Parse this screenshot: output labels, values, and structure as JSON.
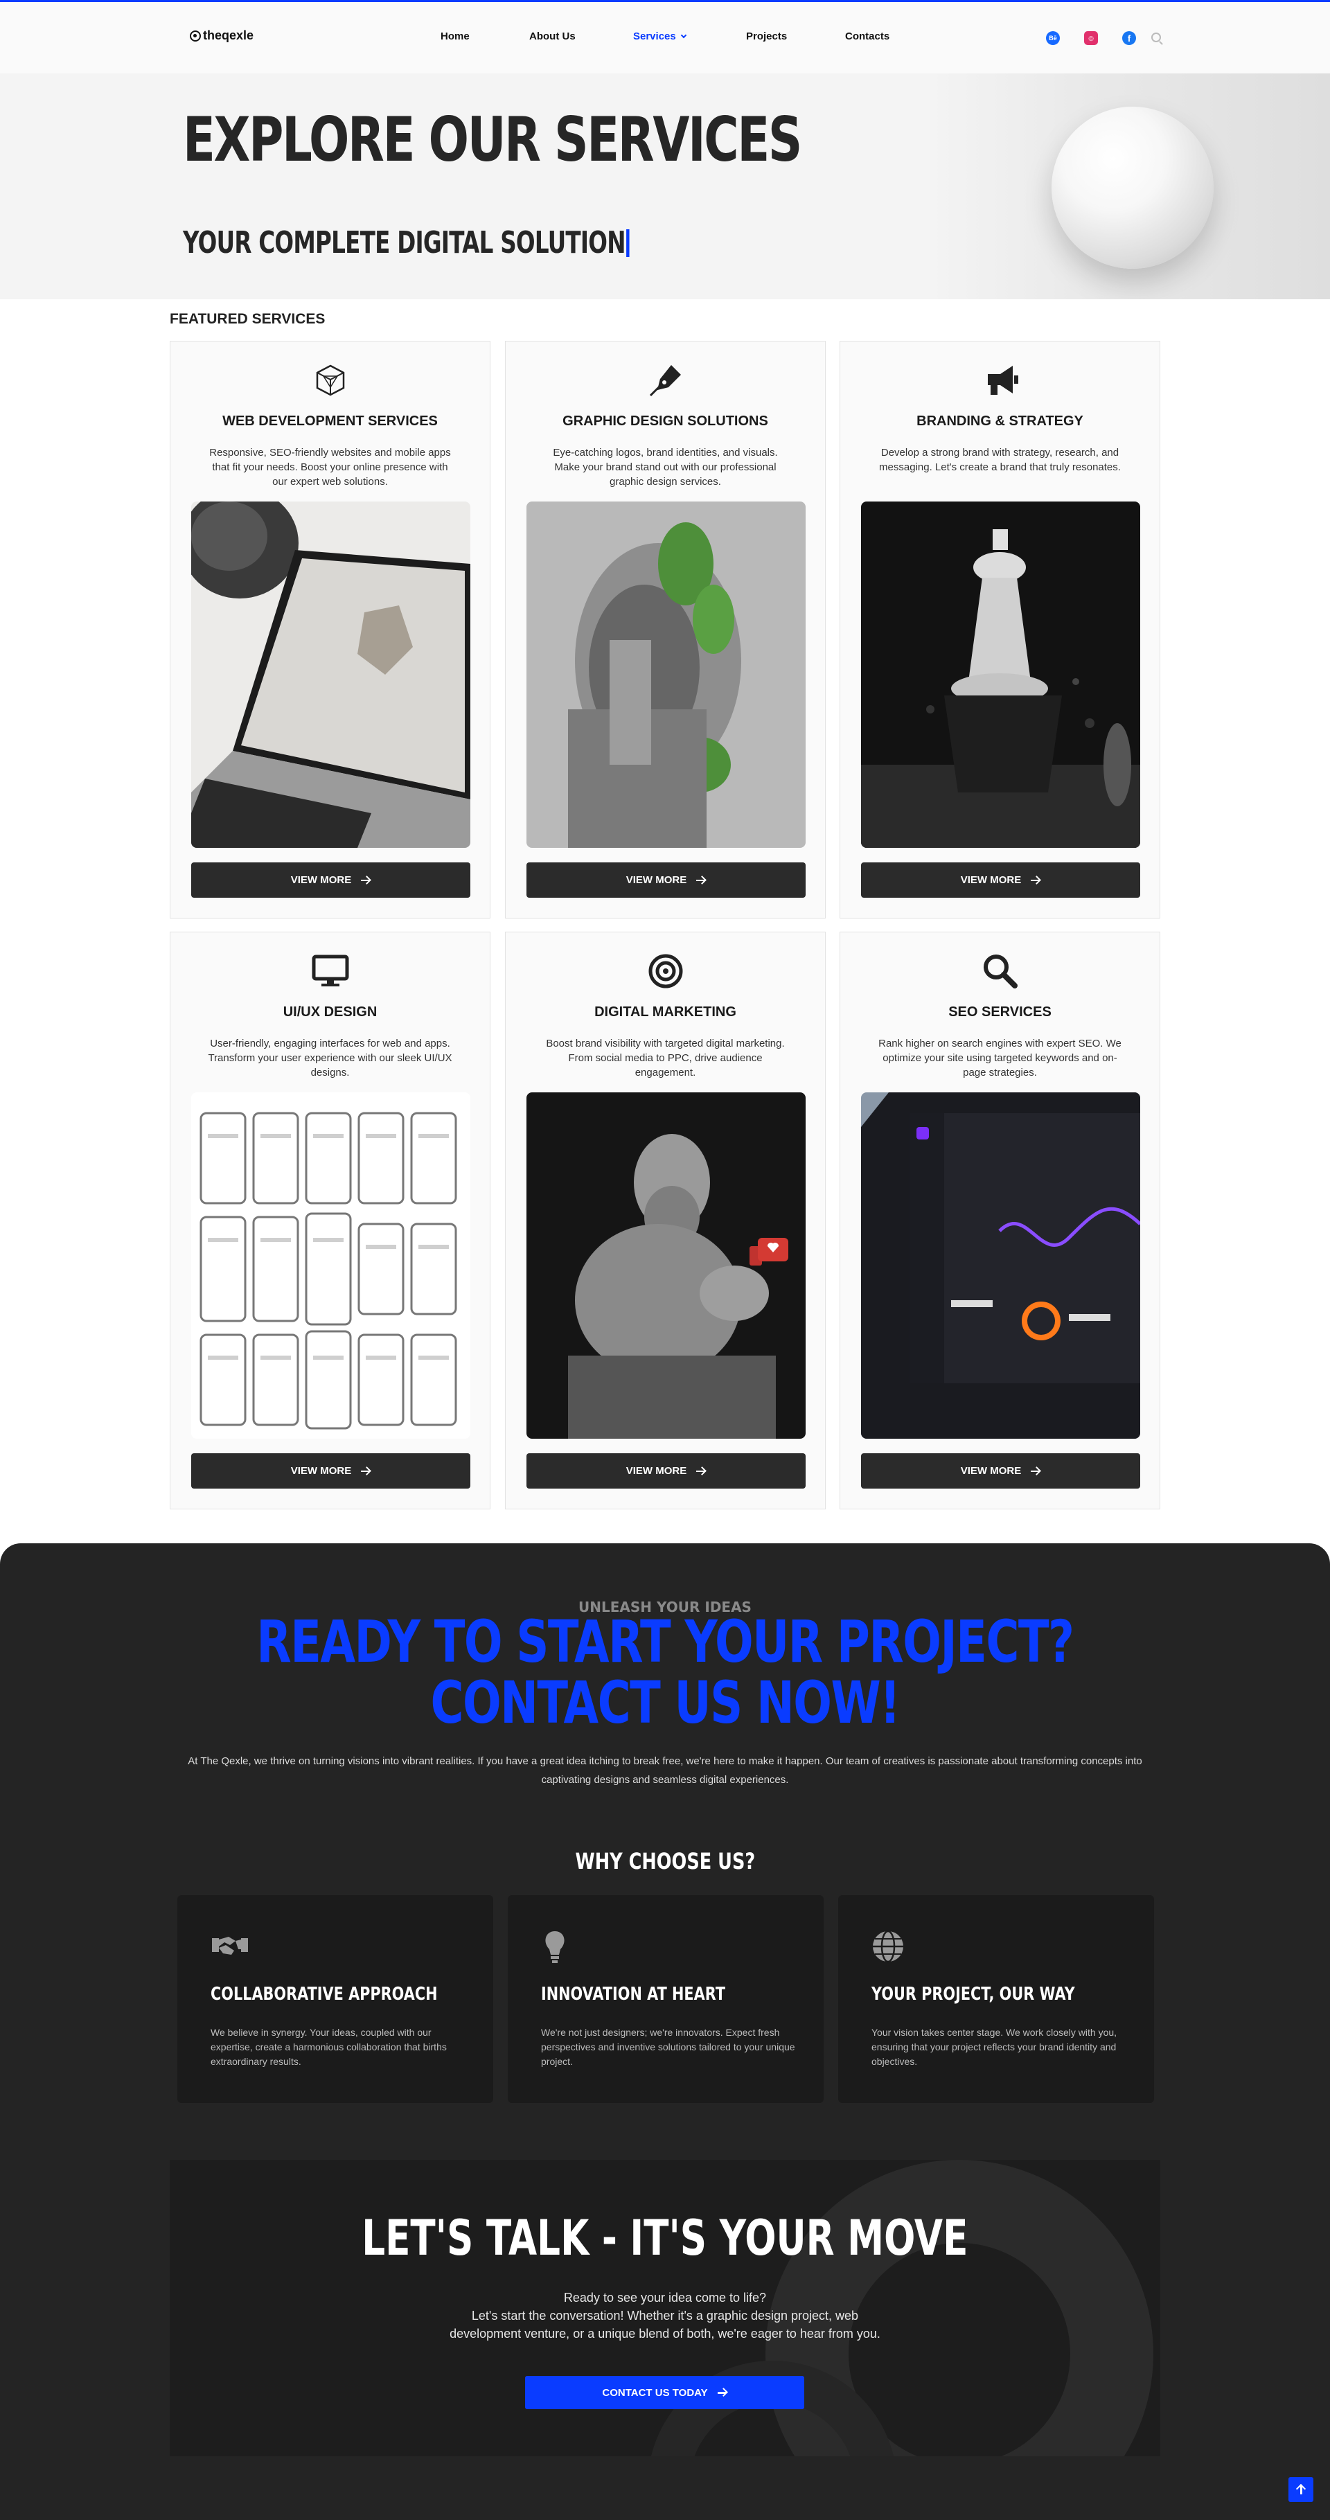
{
  "header": {
    "logo": "theqexle",
    "nav": [
      {
        "label": "Home"
      },
      {
        "label": "About Us"
      },
      {
        "label": "Services"
      },
      {
        "label": "Projects"
      },
      {
        "label": "Contacts"
      }
    ],
    "active_nav": "Services",
    "social_icons": [
      "behance-icon",
      "instagram-icon",
      "facebook-icon",
      "search-icon"
    ],
    "social_labels": {
      "behance": "Bē",
      "instagram": "◎",
      "facebook": "f"
    }
  },
  "hero": {
    "title": "EXPLORE OUR SERVICES",
    "subtitle": "YOUR COMPLETE DIGITAL SOLUTION"
  },
  "featured": {
    "label": "FEATURED SERVICES",
    "cards": [
      {
        "title": "WEB DEVELOPMENT SERVICES",
        "description": "Responsive, SEO-friendly websites and mobile apps that fit your needs. Boost your online presence with our expert web solutions.",
        "icon": "cube-icon",
        "button": "VIEW MORE"
      },
      {
        "title": "GRAPHIC DESIGN SOLUTIONS",
        "description": "Eye-catching logos, brand identities, and visuals. Make your brand stand out with our professional graphic design services.",
        "icon": "pen-nib-icon",
        "button": "VIEW MORE"
      },
      {
        "title": "BRANDING & STRATEGY",
        "description": "Develop a strong brand with strategy, research, and messaging. Let's create a brand that truly resonates.",
        "icon": "megaphone-icon",
        "button": "VIEW MORE"
      },
      {
        "title": "UI/UX DESIGN",
        "description": "User-friendly, engaging interfaces for web and apps. Transform your user experience with our sleek UI/UX designs.",
        "icon": "monitor-icon",
        "button": "VIEW MORE"
      },
      {
        "title": "DIGITAL MARKETING",
        "description": "Boost brand visibility with targeted digital marketing. From social media to PPC, drive audience engagement.",
        "icon": "target-icon",
        "button": "VIEW MORE"
      },
      {
        "title": "SEO SERVICES",
        "description": "Rank higher on search engines with expert SEO. We optimize your site using targeted keywords and on-page strategies.",
        "icon": "search-icon",
        "button": "VIEW MORE"
      }
    ]
  },
  "cta": {
    "kicker": "UNLEASH YOUR IDEAS",
    "heading_line1": "READY TO START YOUR PROJECT?",
    "heading_line2": "CONTACT US NOW!",
    "paragraph": "At The Qexle, we thrive on turning visions into vibrant realities. If you have a great idea itching to break free, we're here to make it happen. Our team of creatives is passionate about transforming concepts into captivating designs and seamless digital experiences."
  },
  "why": {
    "heading": "WHY CHOOSE US?",
    "items": [
      {
        "title": "COLLABORATIVE APPROACH",
        "text": "We believe in synergy. Your ideas, coupled with our expertise, create a harmonious collaboration that births extraordinary results.",
        "icon": "handshake-icon"
      },
      {
        "title": "INNOVATION AT HEART",
        "text": "We're not just designers; we're innovators. Expect fresh perspectives and inventive solutions tailored to your unique project.",
        "icon": "lightbulb-icon"
      },
      {
        "title": "YOUR PROJECT, OUR WAY",
        "text": "Your vision takes center stage. We work closely with you, ensuring that your project reflects your brand identity and objectives.",
        "icon": "globe-icon"
      }
    ]
  },
  "talk": {
    "title": "LET'S TALK - IT'S YOUR MOVE",
    "line1": "Ready to see your idea come to life?",
    "line2": "Let's start the conversation! Whether it's a graphic design project, web development venture, or a unique blend of both, we're eager to hear from you.",
    "button": "CONTACT US TODAY"
  },
  "colors": {
    "accent": "#0a3cff",
    "dark": "#242424",
    "card_button": "#2b2b2b"
  },
  "scroll_top_icon": "arrow-up-icon"
}
